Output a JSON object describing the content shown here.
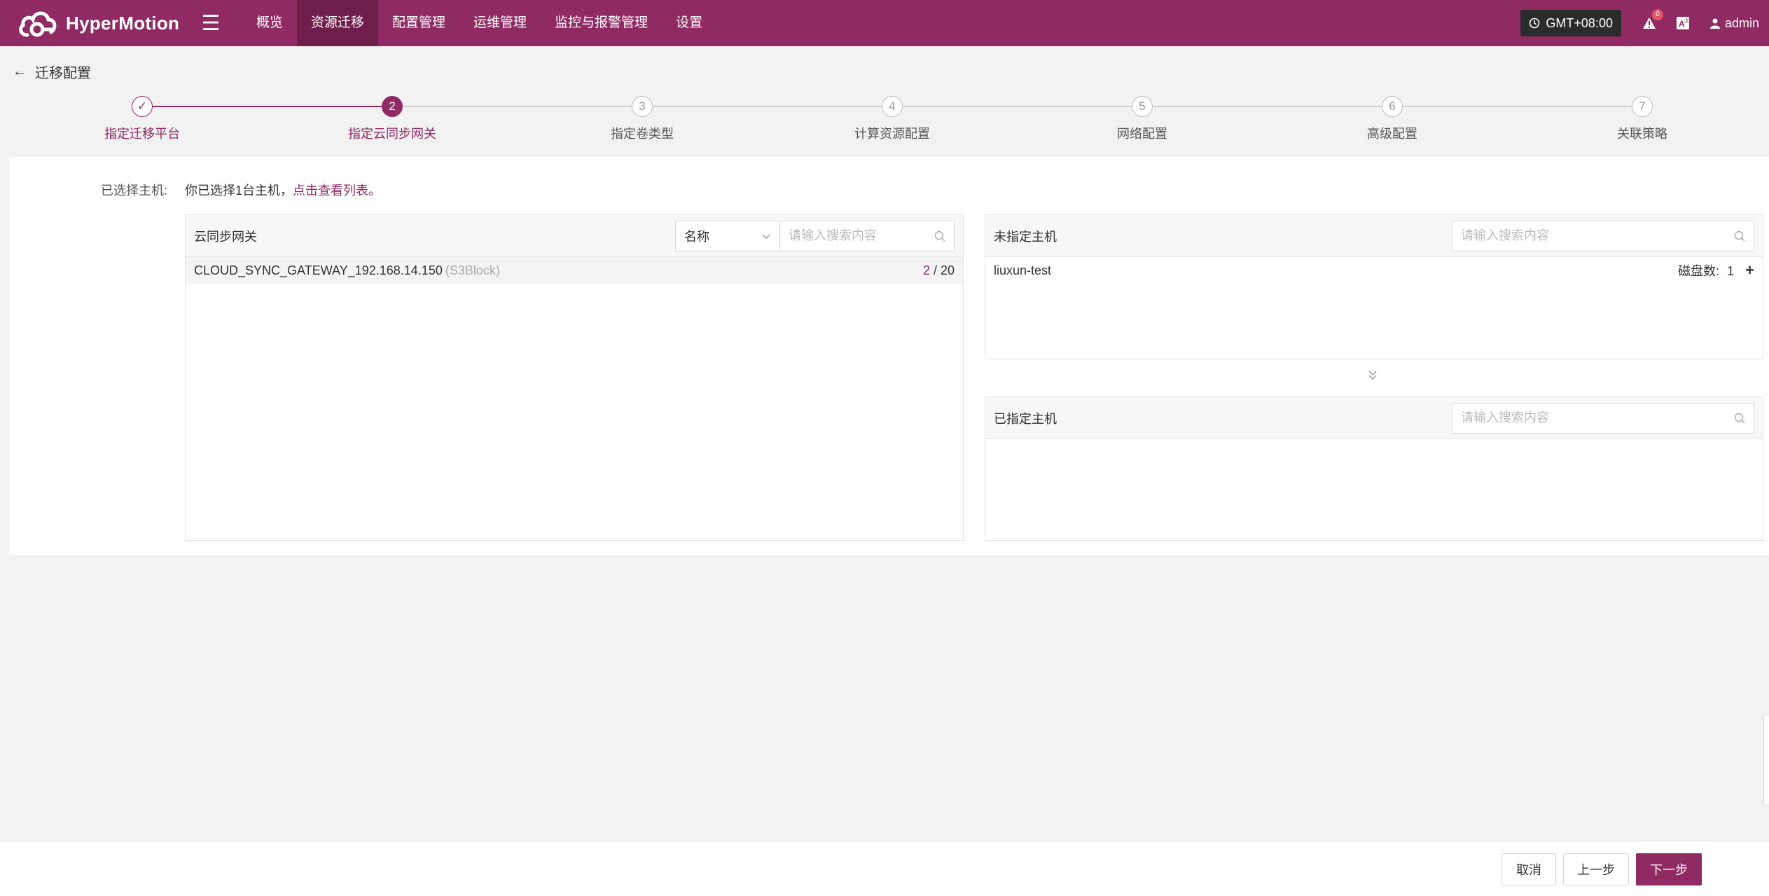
{
  "app": {
    "name": "HyperMotion"
  },
  "nav": {
    "items": [
      {
        "label": "概览"
      },
      {
        "label": "资源迁移"
      },
      {
        "label": "配置管理"
      },
      {
        "label": "运维管理"
      },
      {
        "label": "监控与报警管理"
      },
      {
        "label": "设置"
      }
    ],
    "active_index": 1
  },
  "topbar": {
    "timezone": "GMT+08:00",
    "alert_count": "0",
    "user": "admin"
  },
  "page": {
    "title": "迁移配置",
    "back_icon": "arrow-left-icon"
  },
  "steps": [
    {
      "num": "✓",
      "label": "指定迁移平台",
      "state": "done"
    },
    {
      "num": "2",
      "label": "指定云同步网关",
      "state": "active"
    },
    {
      "num": "3",
      "label": "指定卷类型",
      "state": "pending"
    },
    {
      "num": "4",
      "label": "计算资源配置",
      "state": "pending"
    },
    {
      "num": "5",
      "label": "网络配置",
      "state": "pending"
    },
    {
      "num": "6",
      "label": "高级配置",
      "state": "pending"
    },
    {
      "num": "7",
      "label": "关联策略",
      "state": "pending"
    }
  ],
  "selected_hosts": {
    "label": "已选择主机:",
    "text": "你已选择1台主机，",
    "link": "点击查看列表。"
  },
  "gateway_panel": {
    "title": "云同步网关",
    "filter_value": "名称",
    "search_placeholder": "请输入搜索内容",
    "rows": [
      {
        "name": "CLOUD_SYNC_GATEWAY_192.168.14.150",
        "tag": "(S3Block)",
        "used": "2",
        "total": " / 20"
      }
    ]
  },
  "unassigned_panel": {
    "title": "未指定主机",
    "search_placeholder": "请输入搜索内容",
    "rows": [
      {
        "name": "liuxun-test",
        "disk_label": "磁盘数:",
        "disk_count": "1",
        "add": "+"
      }
    ]
  },
  "assigned_panel": {
    "title": "已指定主机",
    "search_placeholder": "请输入搜索内容"
  },
  "footer": {
    "cancel": "取消",
    "prev": "上一步",
    "next": "下一步"
  }
}
